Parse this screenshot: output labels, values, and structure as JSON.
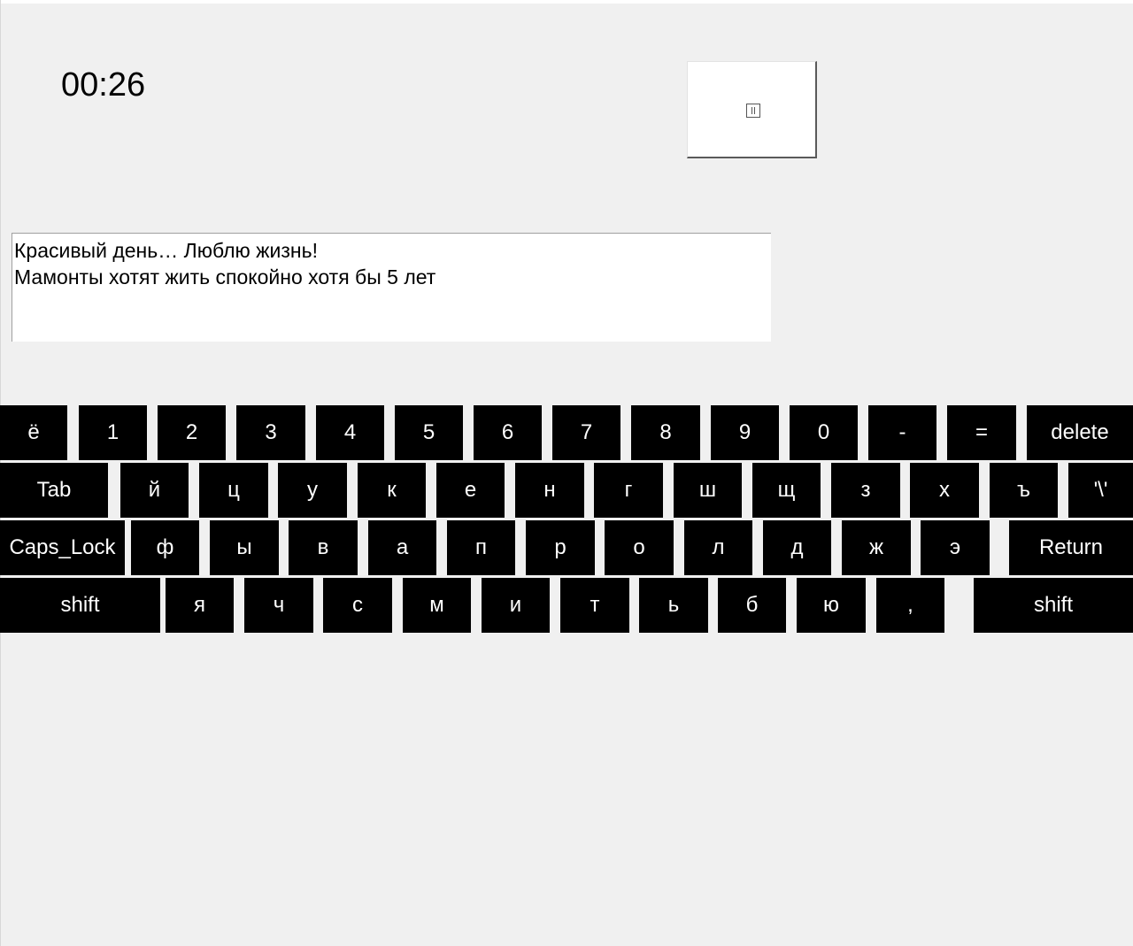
{
  "timer": {
    "value": "00:26"
  },
  "pause_button": {
    "icon": "pause-icon"
  },
  "text_area": {
    "lines": [
      "Красивый день… Люблю жизнь!",
      "Мамонты хотят жить спокойно хотя бы 5 лет"
    ]
  },
  "keyboard": {
    "rows": [
      [
        "ё",
        "1",
        "2",
        "3",
        "4",
        "5",
        "6",
        "7",
        "8",
        "9",
        "0",
        "-",
        "=",
        "delete"
      ],
      [
        "Tab",
        "й",
        "ц",
        "у",
        "к",
        "е",
        "н",
        "г",
        "ш",
        "щ",
        "з",
        "х",
        "ъ",
        "'\\'"
      ],
      [
        "Caps_Lock",
        "ф",
        "ы",
        "в",
        "а",
        "п",
        "р",
        "о",
        "л",
        "д",
        "ж",
        "э",
        "Return"
      ],
      [
        "shift",
        "я",
        "ч",
        "с",
        "м",
        "и",
        "т",
        "ь",
        "б",
        "ю",
        ",",
        "shift"
      ]
    ],
    "colors": {
      "key_bg": "#000000",
      "key_text": "#ffffff"
    }
  }
}
